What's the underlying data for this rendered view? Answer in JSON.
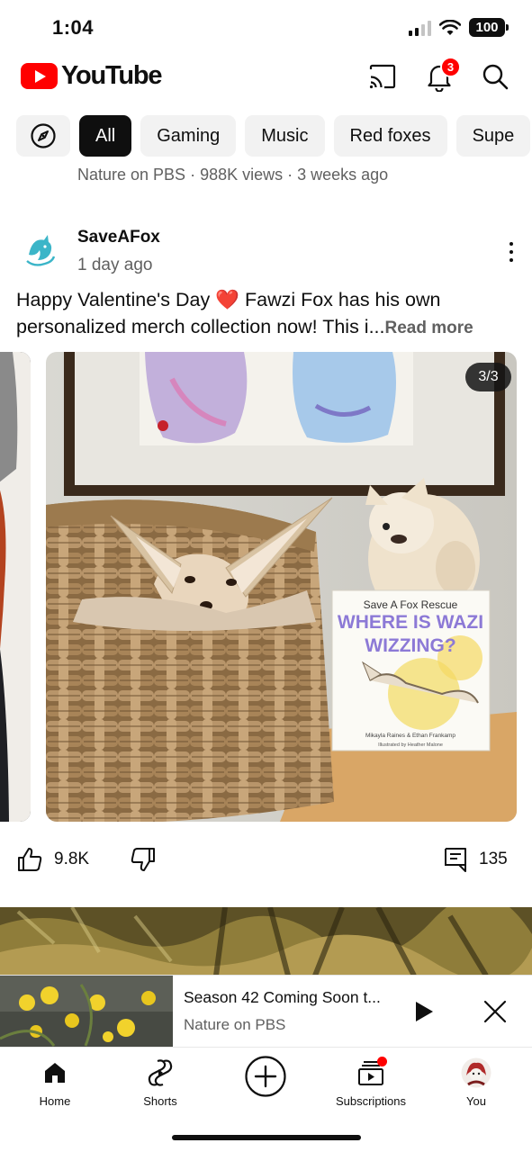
{
  "status_bar": {
    "time": "1:04",
    "battery": "100"
  },
  "header": {
    "logo_text": "YouTube",
    "notification_count": "3",
    "icons": [
      "cast-icon",
      "bell-icon",
      "search-icon"
    ]
  },
  "chips": [
    {
      "label": "All",
      "active": true
    },
    {
      "label": "Gaming"
    },
    {
      "label": "Music"
    },
    {
      "label": "Red foxes"
    },
    {
      "label": "Supe"
    }
  ],
  "previous_item_meta": "Nature on PBS · 988K views · 3 weeks ago",
  "post": {
    "channel": "SaveAFox",
    "time": "1 day ago",
    "text_before_heart": "Happy Valentine's Day ",
    "heart": "❤️",
    "text_after_heart": " Fawzi Fox has his own personalized merch collection now! This i...",
    "read_more": "Read more",
    "image_counter": "3/3",
    "book": {
      "publisher": "Save A Fox Rescue",
      "title_line1": "WHERE IS WAZI",
      "title_line2": "WIZZING?",
      "authors": "Mikayla Raines & Ethan Frankamp",
      "illustrator": "Illustrated by Heather Malone"
    },
    "likes": "9.8K",
    "comments": "135"
  },
  "mini_player": {
    "title": "Season 42 Coming Soon t...",
    "channel": "Nature on PBS"
  },
  "bottom_nav": {
    "home": "Home",
    "shorts": "Shorts",
    "subscriptions": "Subscriptions",
    "you": "You"
  },
  "colors": {
    "brand_red": "#ff0000",
    "text": "#0f0f0f",
    "secondary_text": "#606060",
    "chip_bg": "#f2f2f2"
  }
}
